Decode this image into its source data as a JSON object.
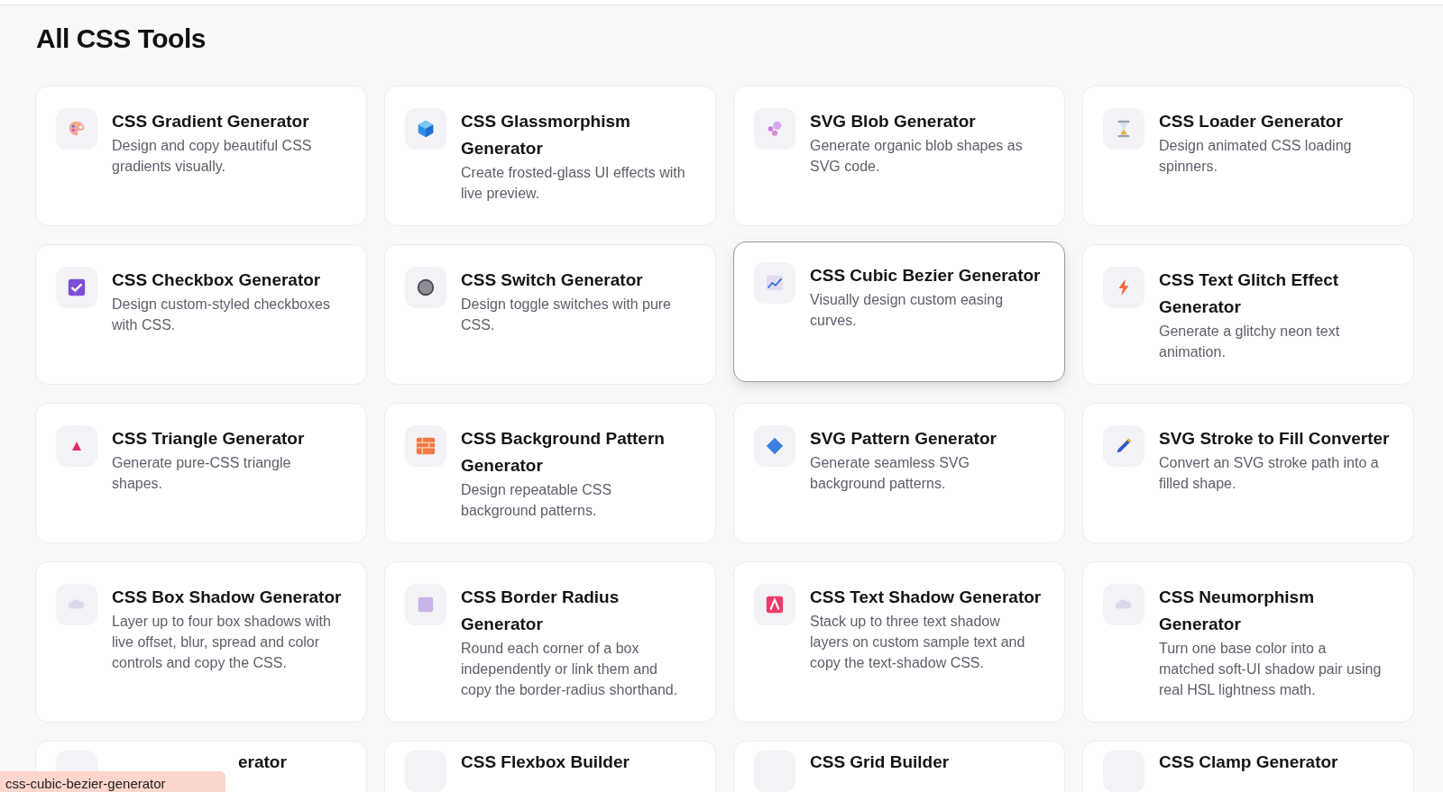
{
  "heading": "All CSS Tools",
  "tools": [
    {
      "title": "CSS Gradient Generator",
      "description": "Design and copy beautiful CSS gradients visually.",
      "hovered": false
    },
    {
      "title": "CSS Glassmorphism Generator",
      "description": "Create frosted-glass UI effects with live preview.",
      "hovered": false
    },
    {
      "title": "SVG Blob Generator",
      "description": "Generate organic blob shapes as SVG code.",
      "hovered": false
    },
    {
      "title": "CSS Loader Generator",
      "description": "Design animated CSS loading spinners.",
      "hovered": false
    },
    {
      "title": "CSS Checkbox Generator",
      "description": "Design custom-styled checkboxes with CSS.",
      "hovered": false
    },
    {
      "title": "CSS Switch Generator",
      "description": "Design toggle switches with pure CSS.",
      "hovered": false
    },
    {
      "title": "CSS Cubic Bezier Generator",
      "description": "Visually design custom easing curves.",
      "hovered": true
    },
    {
      "title": "CSS Text Glitch Effect Generator",
      "description": "Generate a glitchy neon text animation.",
      "hovered": false
    },
    {
      "title": "CSS Triangle Generator",
      "description": "Generate pure-CSS triangle shapes.",
      "hovered": false
    },
    {
      "title": "CSS Background Pattern Generator",
      "description": "Design repeatable CSS background patterns.",
      "hovered": false
    },
    {
      "title": "SVG Pattern Generator",
      "description": "Generate seamless SVG background patterns.",
      "hovered": false
    },
    {
      "title": "SVG Stroke to Fill Converter",
      "description": "Convert an SVG stroke path into a filled shape.",
      "hovered": false
    },
    {
      "title": "CSS Box Shadow Generator",
      "description": "Layer up to four box shadows with live offset, blur, spread and color controls and copy the CSS.",
      "hovered": false
    },
    {
      "title": "CSS Border Radius Generator",
      "description": "Round each corner of a box independently or link them and copy the border-radius shorthand.",
      "hovered": false
    },
    {
      "title": "CSS Text Shadow Generator",
      "description": "Stack up to three text shadow layers on custom sample text and copy the text-shadow CSS.",
      "hovered": false
    },
    {
      "title": "CSS Neumorphism Generator",
      "description": "Turn one base color into a matched soft-UI shadow pair using real HSL lightness math.",
      "hovered": false
    }
  ],
  "more_tools": [
    {
      "title": "erator"
    },
    {
      "title": "CSS Flexbox Builder"
    },
    {
      "title": "CSS Grid Builder"
    },
    {
      "title": "CSS Clamp Generator"
    }
  ],
  "link_preview": "css-cubic-bezier-generator"
}
